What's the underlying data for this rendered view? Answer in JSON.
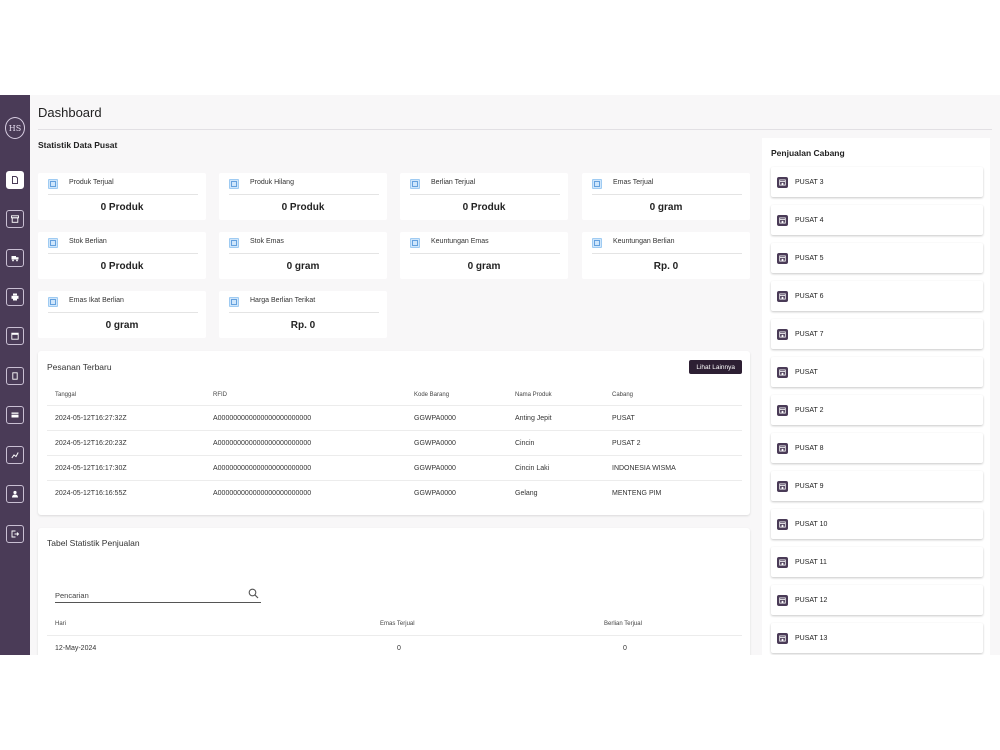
{
  "app": {
    "logo_text": "HS",
    "accent_color": "#4a3b57"
  },
  "sidebar": {
    "items": [
      {
        "icon": "document-icon",
        "active": true
      },
      {
        "icon": "archive-icon",
        "active": false
      },
      {
        "icon": "truck-icon",
        "active": false
      },
      {
        "icon": "printer-icon",
        "active": false
      },
      {
        "icon": "calendar-icon",
        "active": false
      },
      {
        "icon": "bookmark-icon",
        "active": false
      },
      {
        "icon": "card-icon",
        "active": false
      },
      {
        "icon": "chart-icon",
        "active": false
      },
      {
        "icon": "user-icon",
        "active": false
      },
      {
        "icon": "logout-icon",
        "active": false
      }
    ]
  },
  "header": {
    "title": "Dashboard"
  },
  "stats": {
    "section_title": "Statistik Data Pusat",
    "cards": [
      {
        "label": "Produk Terjual",
        "value": "0 Produk"
      },
      {
        "label": "Produk Hilang",
        "value": "0 Produk"
      },
      {
        "label": "Berlian Terjual",
        "value": "0 Produk"
      },
      {
        "label": "Emas Terjual",
        "value": "0 gram"
      },
      {
        "label": "Stok Berlian",
        "value": "0 Produk"
      },
      {
        "label": "Stok Emas",
        "value": "0 gram"
      },
      {
        "label": "Keuntungan Emas",
        "value": "0 gram"
      },
      {
        "label": "Keuntungan Berlian",
        "value": "Rp. 0"
      },
      {
        "label": "Emas Ikat Berlian",
        "value": "0 gram"
      },
      {
        "label": "Harga Berlian Terikat",
        "value": "Rp. 0"
      }
    ]
  },
  "orders": {
    "title": "Pesanan Terbaru",
    "more_label": "Lihat Lainnya",
    "columns": [
      "Tanggal",
      "RFID",
      "Kode Barang",
      "Nama Produk",
      "Cabang"
    ],
    "rows": [
      [
        "2024-05-12T16:27:32Z",
        "A000000000000000000000000",
        "GGWPA0000",
        "Anting Jepit",
        "PUSAT"
      ],
      [
        "2024-05-12T16:20:23Z",
        "A000000000000000000000000",
        "GGWPA0000",
        "Cincin",
        "PUSAT 2"
      ],
      [
        "2024-05-12T16:17:30Z",
        "A000000000000000000000000",
        "GGWPA0000",
        "Cincin Laki",
        "INDONESIA WISMA"
      ],
      [
        "2024-05-12T16:16:55Z",
        "A000000000000000000000000",
        "GGWPA0000",
        "Gelang",
        "MENTENG PIM"
      ]
    ]
  },
  "sales_stats": {
    "title": "Tabel Statistik Penjualan",
    "search_placeholder": "Pencarian",
    "columns": [
      "Hari",
      "Emas Terjual",
      "Berlian Terjual"
    ],
    "rows": [
      [
        "12-May-2024",
        "0",
        "0"
      ]
    ]
  },
  "branches": {
    "title": "Penjualan Cabang",
    "items": [
      "PUSAT 3",
      "PUSAT 4",
      "PUSAT 5",
      "PUSAT 6",
      "PUSAT 7",
      "PUSAT",
      "PUSAT 2",
      "PUSAT 8",
      "PUSAT 9",
      "PUSAT 10",
      "PUSAT 11",
      "PUSAT 12",
      "PUSAT 13"
    ]
  }
}
